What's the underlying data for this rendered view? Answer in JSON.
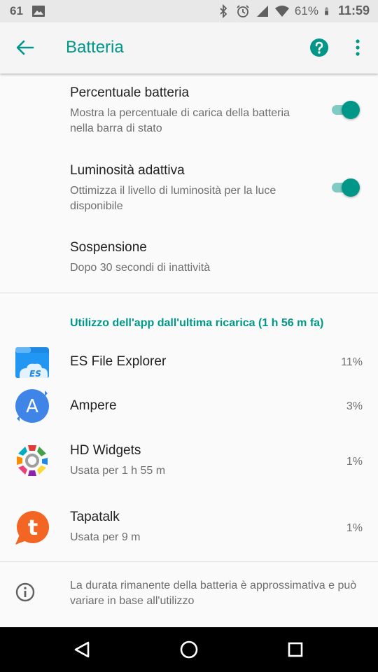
{
  "status_bar": {
    "notification_count": "61",
    "battery_percent": "61%",
    "time": "11:59"
  },
  "app_bar": {
    "title": "Batteria"
  },
  "settings": [
    {
      "title": "Percentuale batteria",
      "summary": "Mostra la percentuale di carica della batteria nella barra di stato",
      "toggle_on": true
    },
    {
      "title": "Luminosità adattiva",
      "summary": "Ottimizza il livello di luminosità per la luce disponibile",
      "toggle_on": true
    },
    {
      "title": "Sospensione",
      "summary": "Dopo 30 secondi di inattività"
    }
  ],
  "usage": {
    "header": "Utilizzo dell'app dall'ultima ricarica (1 h 56 m fa)",
    "apps": [
      {
        "name": "ES File Explorer",
        "detail": "",
        "percent": "11%"
      },
      {
        "name": "Ampere",
        "detail": "",
        "percent": "3%"
      },
      {
        "name": "HD Widgets",
        "detail": "Usata per 1 h 55 m",
        "percent": "1%"
      },
      {
        "name": "Tapatalk",
        "detail": "Usata per 9 m",
        "percent": "1%"
      }
    ]
  },
  "footer": {
    "info_text": "La durata rimanente della batteria è approssimativa e può variare in base all'utilizzo"
  },
  "colors": {
    "accent": "#009688",
    "accent_light": "#80cbc4",
    "ampere": "#3f85e8",
    "tapatalk": "#f26522"
  }
}
